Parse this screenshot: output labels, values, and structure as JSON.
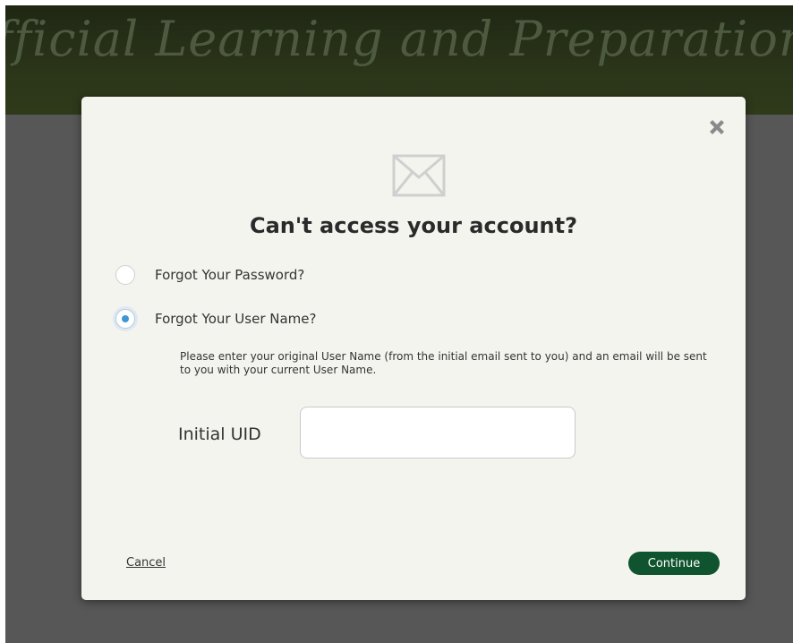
{
  "banner": {
    "text": "fficial Learning and Preparation a"
  },
  "modal": {
    "title": "Can't access your account?",
    "close_icon": "close-x-icon",
    "mail_icon": "envelope-icon",
    "options": [
      {
        "label": "Forgot Your Password?",
        "selected": false
      },
      {
        "label": "Forgot Your User Name?",
        "selected": true
      }
    ],
    "instructions": "Please enter your original User Name (from the initial email sent to you) and an email will be sent to you with your current User Name.",
    "uid_field": {
      "label": "Initial UID",
      "value": "",
      "placeholder": ""
    },
    "cancel_label": "Cancel",
    "continue_label": "Continue"
  },
  "colors": {
    "backdrop": "#575757",
    "banner": "#2b3519",
    "modal_bg": "#f4f4ef",
    "continue_button": "#10542f",
    "radio_selected": "#3e96d6"
  }
}
